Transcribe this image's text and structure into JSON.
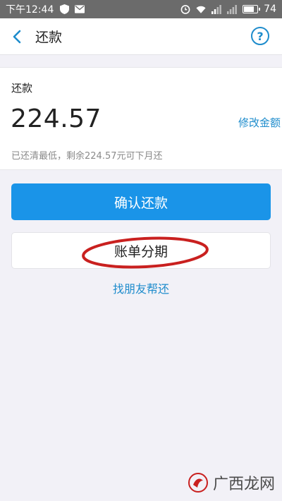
{
  "statusbar": {
    "time": "下午12:44",
    "battery": "74"
  },
  "nav": {
    "title": "还款",
    "help_symbol": "?"
  },
  "repay": {
    "label": "还款",
    "amount": "224.57",
    "modify_link": "修改金额",
    "hint": "已还清最低，剩余224.57元可下月还"
  },
  "actions": {
    "confirm": "确认还款",
    "installment": "账单分期",
    "friend": "找朋友帮还"
  },
  "watermark": {
    "text": "广西龙网"
  },
  "colors": {
    "accent": "#1a94e8",
    "link": "#1e8ccc",
    "annotation": "#c9201f"
  }
}
